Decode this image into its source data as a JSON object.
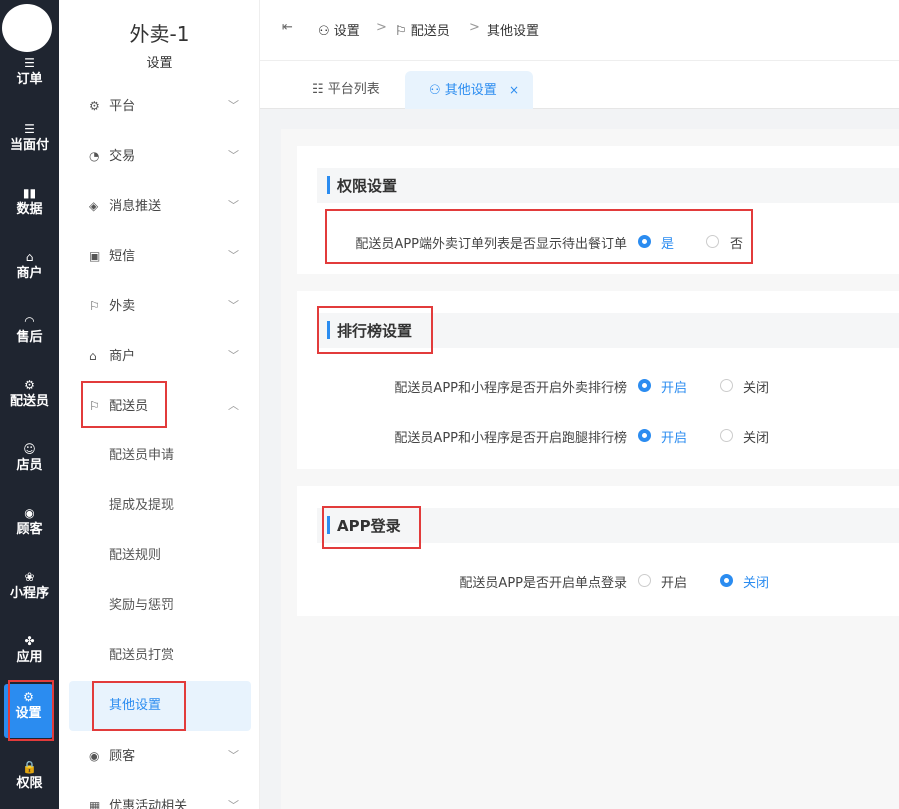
{
  "rail": {
    "items": [
      {
        "icon": "☰",
        "label": "订单"
      },
      {
        "icon": "☰",
        "label": "当面付"
      },
      {
        "icon": "▮▮",
        "label": "数据"
      },
      {
        "icon": "⌂",
        "label": "商户"
      },
      {
        "icon": "◠",
        "label": "售后"
      },
      {
        "icon": "⚙",
        "label": "配送员"
      },
      {
        "icon": "☺",
        "label": "店员"
      },
      {
        "icon": "◉",
        "label": "顾客"
      },
      {
        "icon": "❀",
        "label": "小程序"
      },
      {
        "icon": "✤",
        "label": "应用"
      },
      {
        "icon": "⚙",
        "label": "设置"
      },
      {
        "icon": "🔒",
        "label": "权限"
      }
    ]
  },
  "sidebar": {
    "title": "外卖-1",
    "subtitle": "设置",
    "menu": [
      {
        "icon": "⚙",
        "label": "平台"
      },
      {
        "icon": "◔",
        "label": "交易"
      },
      {
        "icon": "◈",
        "label": "消息推送"
      },
      {
        "icon": "▣",
        "label": "短信"
      },
      {
        "icon": "⚐",
        "label": "外卖"
      },
      {
        "icon": "⌂",
        "label": "商户"
      },
      {
        "icon": "⚐",
        "label": "配送员"
      }
    ],
    "sub_items": [
      "配送员申请",
      "提成及提现",
      "配送规则",
      "奖励与惩罚",
      "配送员打赏",
      "其他设置"
    ],
    "more": [
      {
        "icon": "◉",
        "label": "顾客"
      },
      {
        "icon": "▦",
        "label": "优惠活动相关"
      }
    ]
  },
  "topbar": {
    "collapse_icon": "⇤",
    "breadcrumb": [
      "设置",
      "配送员",
      "其他设置"
    ],
    "separator": ">"
  },
  "tabs": [
    {
      "label": "平台列表",
      "active": false
    },
    {
      "label": "其他设置",
      "active": true,
      "close": "×"
    }
  ],
  "sections": {
    "permission": {
      "title": "权限设置",
      "rows": [
        {
          "label": "配送员APP端外卖订单列表是否显示待出餐订单",
          "options": [
            "是",
            "否"
          ],
          "selected": 0
        }
      ]
    },
    "ranking": {
      "title": "排行榜设置",
      "rows": [
        {
          "label": "配送员APP和小程序是否开启外卖排行榜",
          "options": [
            "开启",
            "关闭"
          ],
          "selected": 0
        },
        {
          "label": "配送员APP和小程序是否开启跑腿排行榜",
          "options": [
            "开启",
            "关闭"
          ],
          "selected": 0
        }
      ]
    },
    "login": {
      "title": "APP登录",
      "rows": [
        {
          "label": "配送员APP是否开启单点登录",
          "options": [
            "开启",
            "关闭"
          ],
          "selected": 1
        }
      ]
    }
  },
  "colors": {
    "accent": "#2b8cf0",
    "highlight": "#e23b3b",
    "rail": "#1f2530"
  }
}
